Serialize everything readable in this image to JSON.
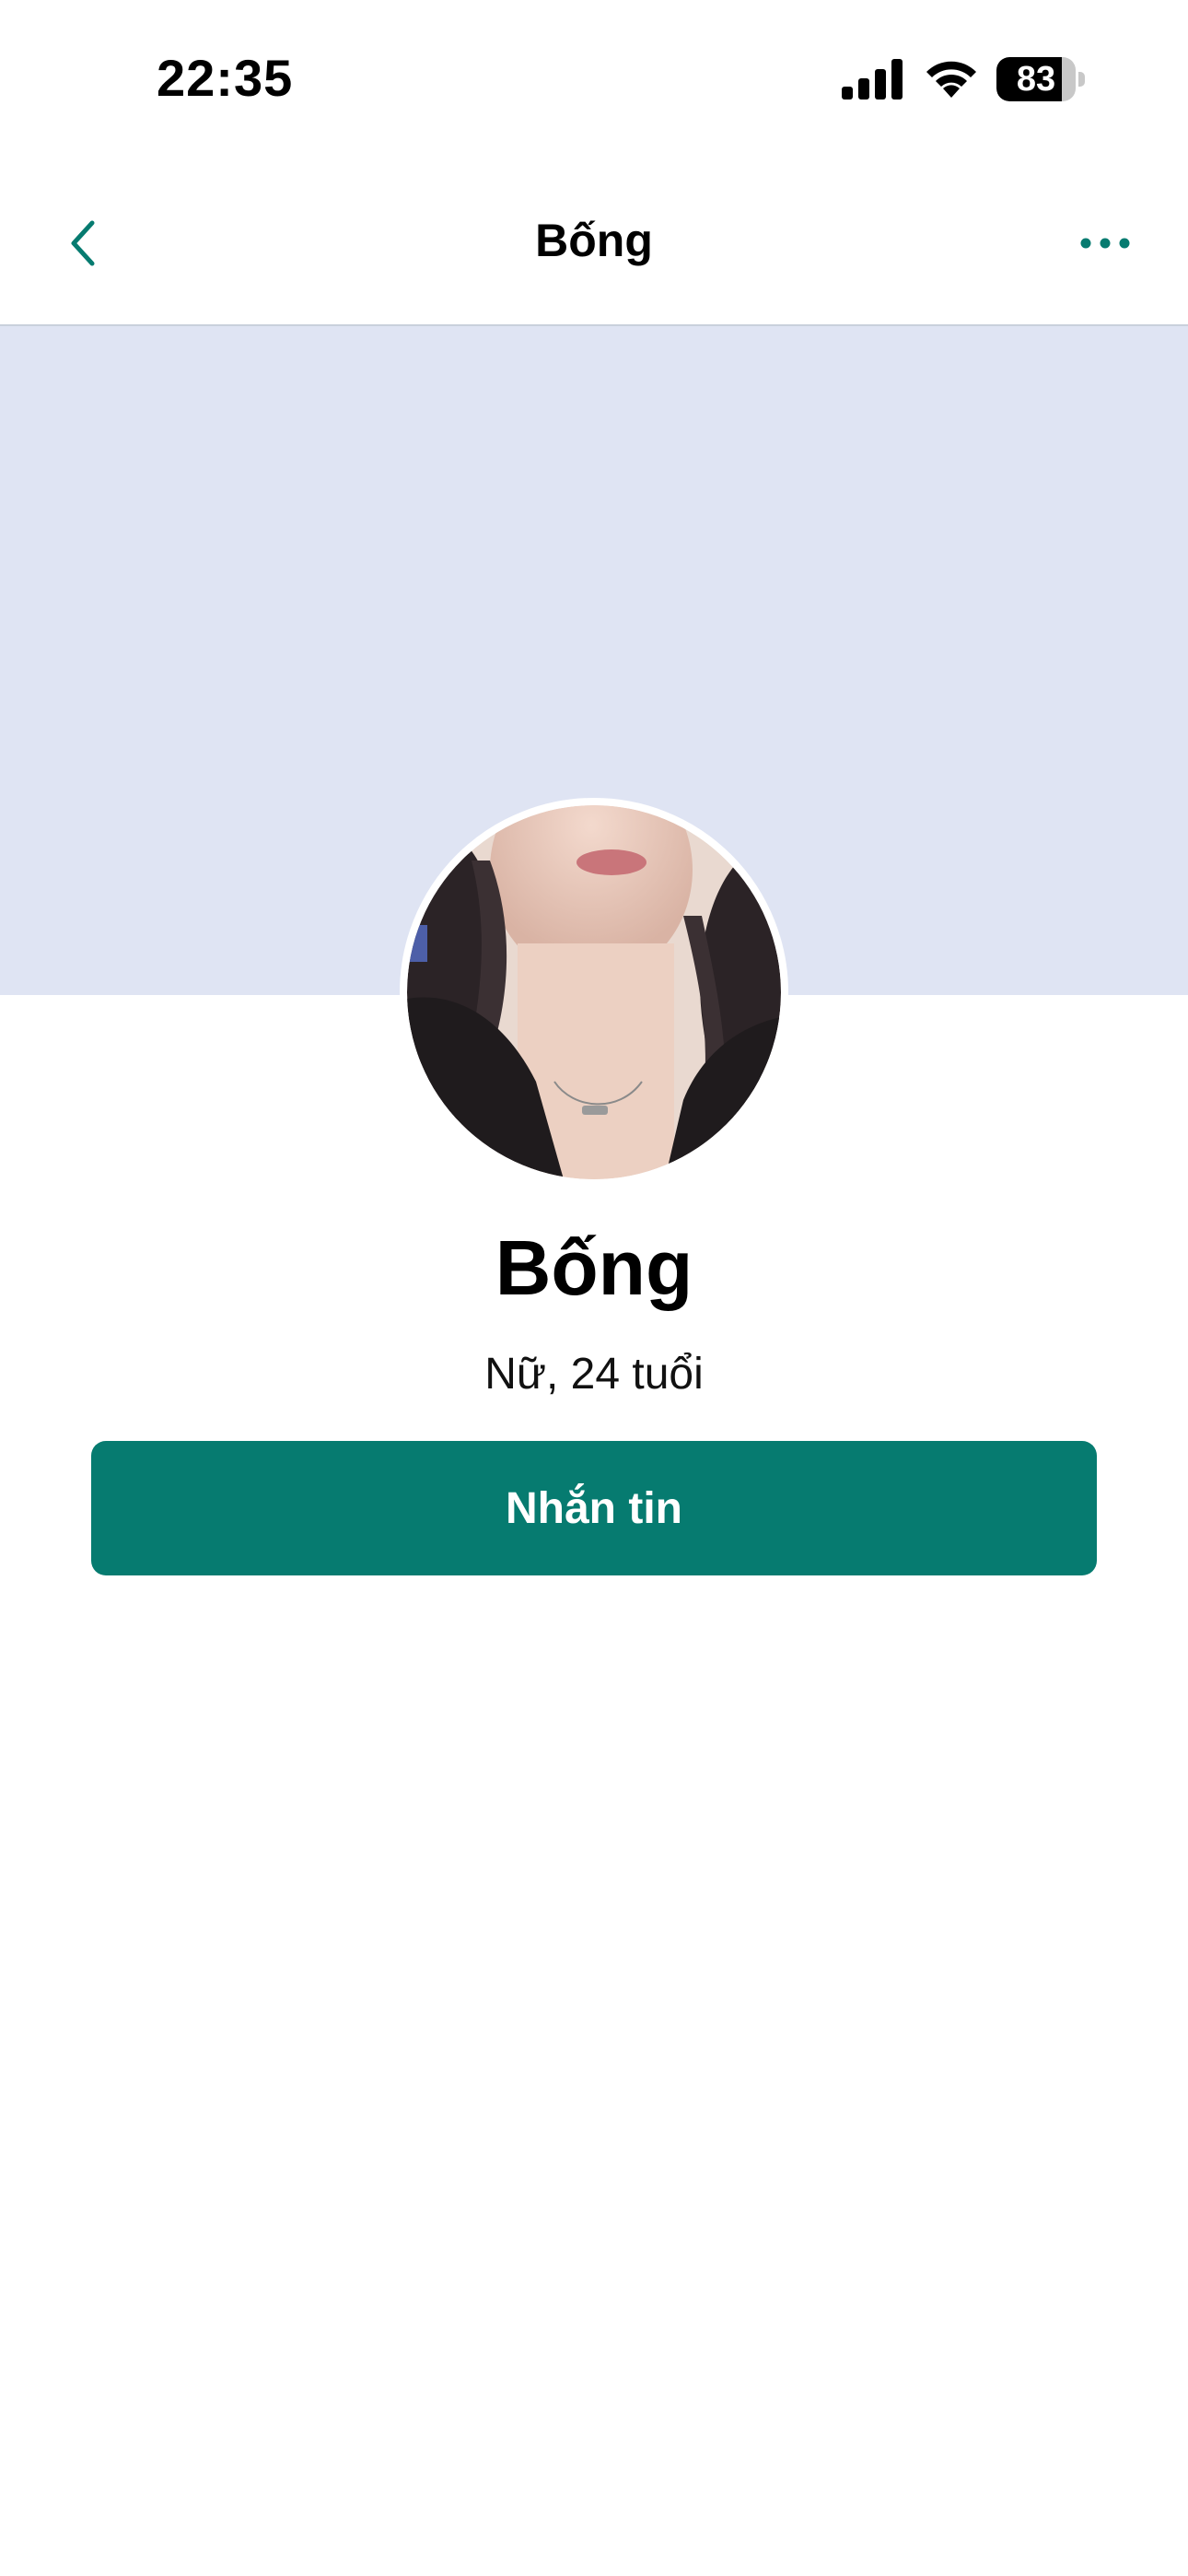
{
  "status_bar": {
    "time": "22:35",
    "battery_level": "83",
    "battery_fraction": 0.83
  },
  "nav": {
    "title": "Bống",
    "back_icon": "chevron-left-icon",
    "more_icon": "ellipsis-horizontal-icon"
  },
  "profile": {
    "name": "Bống",
    "meta": "Nữ, 24 tuổi",
    "message_button_label": "Nhắn tin"
  },
  "colors": {
    "accent": "#067b70",
    "cover": "#dfe4f3"
  }
}
